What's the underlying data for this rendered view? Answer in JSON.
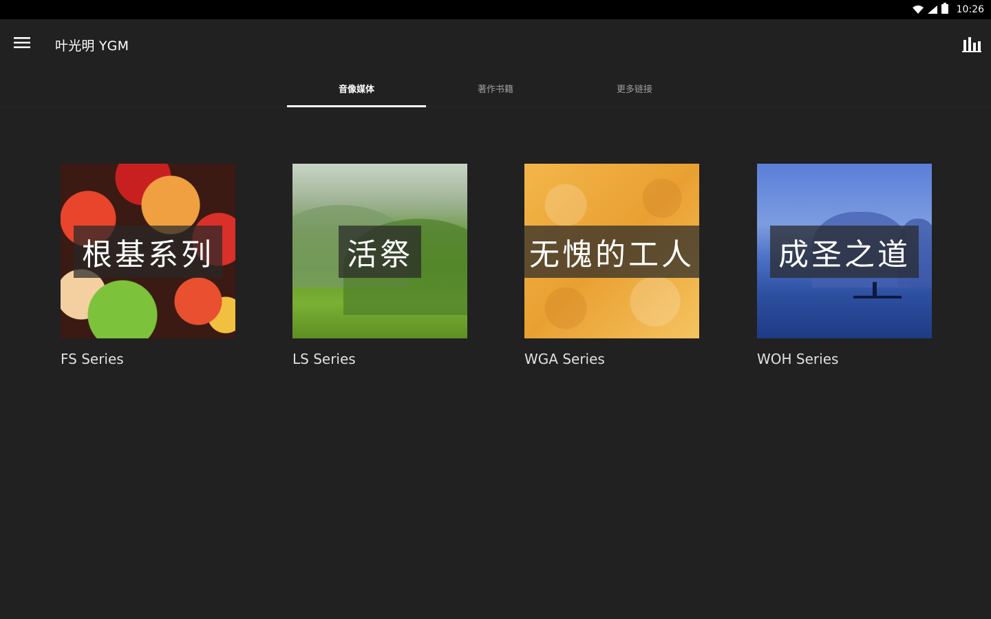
{
  "status_bar": {
    "time": "10:26"
  },
  "app_bar": {
    "title": "叶光明 YGM"
  },
  "tabs": [
    {
      "label": "音像媒体",
      "active": true
    },
    {
      "label": "著作书籍",
      "active": false
    },
    {
      "label": "更多链接",
      "active": false
    }
  ],
  "cards": [
    {
      "overlay": "根基系列",
      "label": "FS Series"
    },
    {
      "overlay": "活祭",
      "label": "LS Series"
    },
    {
      "overlay": "无愧的工人",
      "label": "WGA Series"
    },
    {
      "overlay": "成圣之道",
      "label": "WOH Series"
    }
  ]
}
